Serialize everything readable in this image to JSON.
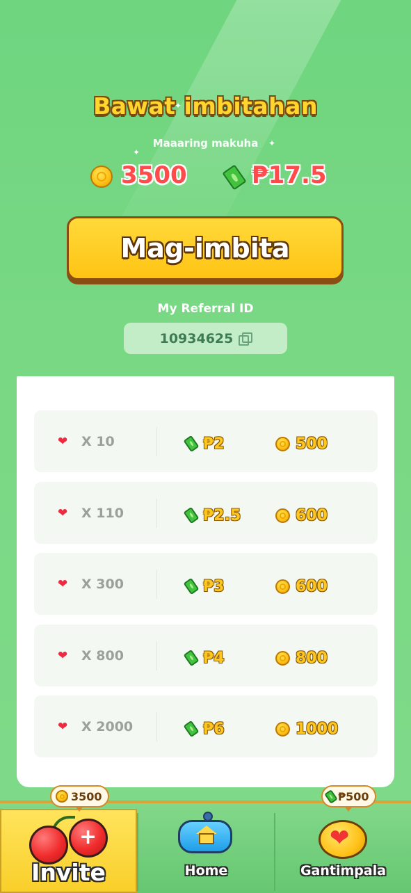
{
  "header": {
    "title": "Bawat imbitahan",
    "subtitle": "Maaaring makuha",
    "total_coins": "3500",
    "total_cash": "₱17.5"
  },
  "invite_button": {
    "label": "Mag-imbita"
  },
  "referral": {
    "label": "My Referral ID",
    "id": "10934625"
  },
  "tiers": [
    {
      "hearts": "X 10",
      "cash": "₱2",
      "coins": "500"
    },
    {
      "hearts": "X 110",
      "cash": "₱2.5",
      "coins": "600"
    },
    {
      "hearts": "X 300",
      "cash": "₱3",
      "coins": "600"
    },
    {
      "hearts": "X 800",
      "cash": "₱4",
      "coins": "800"
    },
    {
      "hearts": "X 2000",
      "cash": "₱6",
      "coins": "1000"
    }
  ],
  "nav": {
    "invite": {
      "label": "Invite",
      "badge": "3500"
    },
    "home": {
      "label": "Home"
    },
    "rewards": {
      "label": "Gantimpala",
      "badge": "₱500"
    }
  },
  "colors": {
    "background": "#78d783",
    "accent_yellow": "#ffc414",
    "amount_red": "#ff4b4b",
    "outline_brown": "#8a4e12"
  },
  "icons": [
    "coin-icon",
    "cash-icon",
    "heart-icon",
    "copy-icon",
    "cherry-plus-icon",
    "home-gamepad-icon",
    "heart-trophy-icon"
  ]
}
